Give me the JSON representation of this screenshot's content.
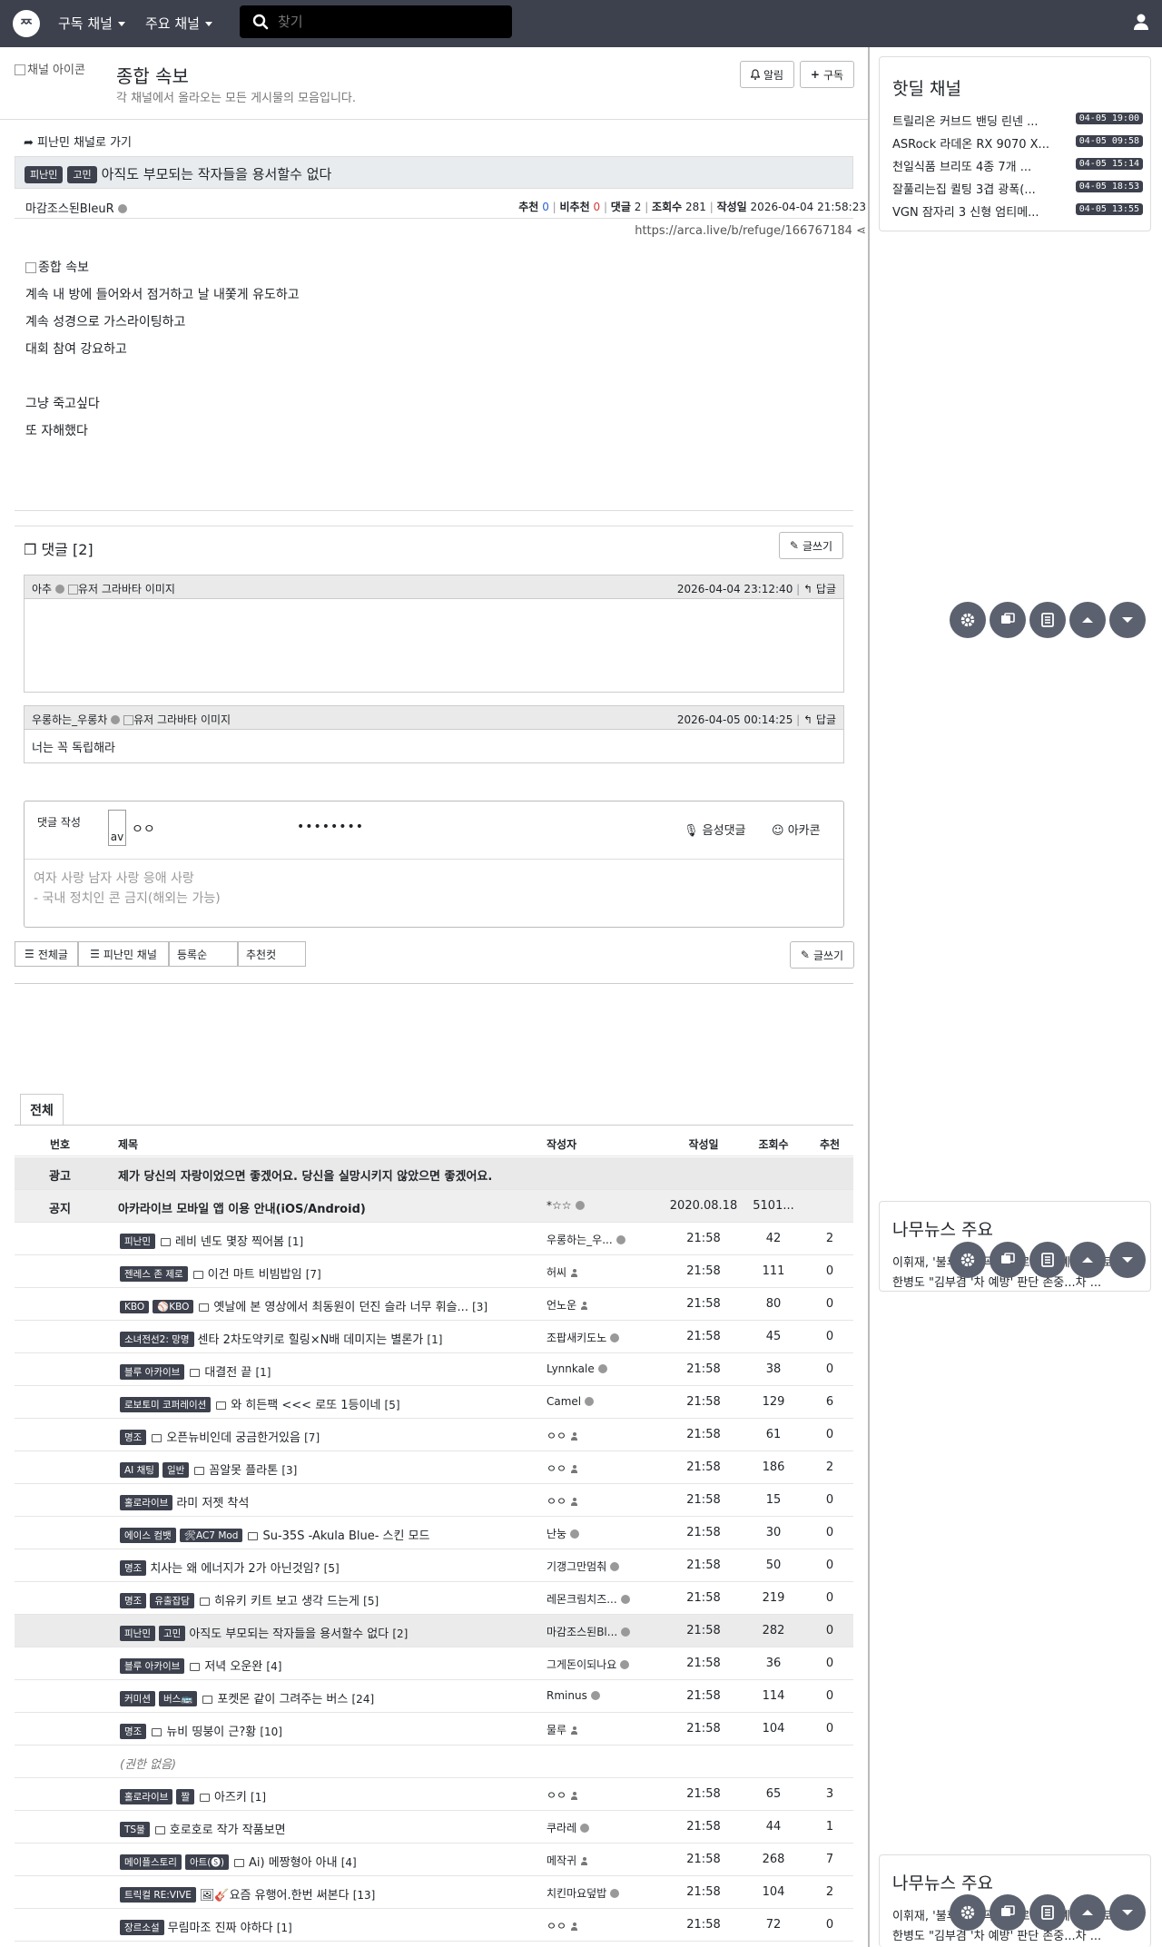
{
  "nav": {
    "logo_text": "ᄍ",
    "subscribed_channels": "구독 채널",
    "major_channels": "주요 채널",
    "search_placeholder": "찾기"
  },
  "header": {
    "channel_icon_alt": "채널 아이콘",
    "title": "종합 속보",
    "subtitle": "각 채널에서 올라오는 모든 게시물의 모음입니다.",
    "alert_label": "알림",
    "subscribe_label": "구독"
  },
  "article": {
    "back_link": "피난민 채널로 가기",
    "badges": [
      "피난민",
      "고민"
    ],
    "title": "아직도 부모되는 작자들을 용서할수 없다",
    "author": "마감조스된BleuR",
    "rec_label": "추천",
    "rec": "0",
    "unrec_label": "비추천",
    "unrec": "0",
    "comments_label": "댓글",
    "comments": "2",
    "views_label": "조회수",
    "views": "281",
    "date_label": "작성일",
    "date": "2026-04-04 21:58:23",
    "url": "https://arca.live/b/refuge/166767184",
    "image_alt": "종합 속보",
    "lines": [
      "계속 내 방에 들어와서 점거하고 날 내쫓게 유도하고",
      "계속 성경으로 가스라이팅하고",
      "대회 참여 강요하고",
      "그냥 죽고싶다",
      "또 자해했다"
    ]
  },
  "comments": {
    "heading": "댓글 [2]",
    "write_label": "글쓰기",
    "reply_label": "답글",
    "avatar_alt": "유저 그라바타 이미지",
    "items": [
      {
        "author": "아추",
        "date": "2026-04-04 23:12:40",
        "text": ""
      },
      {
        "author": "우롱하는_우롱차",
        "date": "2026-04-05 00:14:25",
        "text": "너는 꼭 독립해라"
      }
    ],
    "form": {
      "label": "댓글 작성",
      "avatar_text": "av",
      "nick": "ㅇㅇ",
      "password": "••••••••",
      "voice_label": "음성댓글",
      "arcacon_label": "아카콘",
      "placeholder_1": "여자 사랑 남자 사랑 응애 사랑",
      "placeholder_2": "- 국내 정치인 콘 금지(해외는 가능)"
    }
  },
  "filters": {
    "all": "전체글",
    "channel": "피난민 채널",
    "order": "등록순",
    "best": "추천컷",
    "write": "글쓰기"
  },
  "board": {
    "tab": "전체",
    "headers": {
      "no": "번호",
      "title": "제목",
      "author": "작성자",
      "date": "작성일",
      "views": "조회수",
      "rec": "추천"
    },
    "ad_label": "광고",
    "ad_text": "제가 당신의 자랑이었으면 좋겠어요. 당신을 실망시키지 않았으면 좋겠어요.",
    "notice_label": "공지",
    "notice_title": "아카라이브 모바일 앱 이용 안내(iOS/Android)",
    "notice_author": "*☆☆",
    "notice_date": "2020.08.18",
    "notice_views": "5101...",
    "no_perm": "(권한 없음)",
    "rows": [
      {
        "badges": [
          "피난민"
        ],
        "chip": true,
        "title": "레비 넨도 몇장 찍어봄",
        "cnt": "[1]",
        "author": "우롱하는_우...",
        "atype": "check",
        "date": "21:58",
        "views": "42",
        "rec": "2"
      },
      {
        "badges": [
          "젠레스 존 제로"
        ],
        "chip": true,
        "title": "이건 마트 비빔밥임",
        "cnt": "[7]",
        "author": "허씨",
        "atype": "person",
        "date": "21:58",
        "views": "111",
        "rec": "0"
      },
      {
        "badges": [
          "KBO",
          "⚾KBO"
        ],
        "chip": true,
        "title": "옛날에 본 영상에서 최동원이 던진 슬라 너무 휘슬...",
        "cnt": "[3]",
        "author": "언노운",
        "atype": "person",
        "date": "21:58",
        "views": "80",
        "rec": "0"
      },
      {
        "badges": [
          "소녀전선2: 망명"
        ],
        "chip": false,
        "title": "센타 2차도약키로 힐링×N배 데미지는 별론가",
        "cnt": "[1]",
        "author": "조팝새키도노",
        "atype": "check",
        "date": "21:58",
        "views": "45",
        "rec": "0"
      },
      {
        "badges": [
          "블루 아카이브"
        ],
        "chip": true,
        "title": "대결전 끝",
        "cnt": "[1]",
        "author": "Lynnkale",
        "atype": "check",
        "date": "21:58",
        "views": "38",
        "rec": "0"
      },
      {
        "badges": [
          "로보토미 코퍼레이션"
        ],
        "chip": true,
        "title": "와 히든팩 <<< 로또 1등이네",
        "cnt": "[5]",
        "author": "Camel",
        "atype": "check",
        "date": "21:58",
        "views": "129",
        "rec": "6"
      },
      {
        "badges": [
          "명조"
        ],
        "chip": true,
        "title": "오픈뉴비인데 궁금한거있음",
        "cnt": "[7]",
        "author": "ㅇㅇ",
        "atype": "person",
        "date": "21:58",
        "views": "61",
        "rec": "0"
      },
      {
        "badges": [
          "AI 채팅",
          "일반"
        ],
        "chip": true,
        "title": "꼼알못 플라톤",
        "cnt": "[3]",
        "author": "ㅇㅇ",
        "atype": "person",
        "date": "21:58",
        "views": "186",
        "rec": "2"
      },
      {
        "badges": [
          "홀로라이브"
        ],
        "chip": false,
        "title": "라미 저젯 착석",
        "cnt": "",
        "author": "ㅇㅇ",
        "atype": "person",
        "date": "21:58",
        "views": "15",
        "rec": "0"
      },
      {
        "badges": [
          "에이스 컴뱃",
          "🛠AC7 Mod"
        ],
        "chip": true,
        "title": "Su-35S -Akula Blue- 스킨 모드",
        "cnt": "",
        "author": "난눙",
        "atype": "check",
        "date": "21:58",
        "views": "30",
        "rec": "0"
      },
      {
        "badges": [
          "명조"
        ],
        "chip": false,
        "title": "치사는 왜 에너지가 2가 아닌것임?",
        "cnt": "[5]",
        "author": "기갱그만멈춰",
        "atype": "check",
        "date": "21:58",
        "views": "50",
        "rec": "0"
      },
      {
        "badges": [
          "명조",
          "유출잡담"
        ],
        "chip": true,
        "title": "히유키 키트 보고 생각 드는게",
        "cnt": "[5]",
        "author": "레몬크림치즈...",
        "atype": "check",
        "date": "21:58",
        "views": "219",
        "rec": "0"
      },
      {
        "badges": [
          "피난민",
          "고민"
        ],
        "chip": false,
        "title": "아직도 부모되는 작자들을 용서할수 없다",
        "cnt": "[2]",
        "author": "마감조스된Bl...",
        "atype": "check",
        "date": "21:58",
        "views": "282",
        "rec": "0",
        "active": true
      },
      {
        "badges": [
          "블루 아카이브"
        ],
        "chip": true,
        "title": "저녁 오운완",
        "cnt": "[4]",
        "author": "그게돈이되나요",
        "atype": "check",
        "date": "21:58",
        "views": "36",
        "rec": "0"
      },
      {
        "badges": [
          "커미션",
          "버스🚌"
        ],
        "chip": true,
        "title": "포켓몬 같이 그려주는 버스",
        "cnt": "[24]",
        "author": "Rminus",
        "atype": "check",
        "date": "21:58",
        "views": "114",
        "rec": "0"
      },
      {
        "badges": [
          "명조"
        ],
        "chip": true,
        "title": "뉴비 띵붕이 근?황",
        "cnt": "[10]",
        "author": "물루",
        "atype": "person",
        "date": "21:58",
        "views": "104",
        "rec": "0"
      },
      {
        "noperm": true
      },
      {
        "badges": [
          "홀로라이브",
          "짤"
        ],
        "chip": true,
        "title": "아즈키",
        "cnt": "[1]",
        "author": "ㅇㅇ",
        "atype": "person",
        "date": "21:58",
        "views": "65",
        "rec": "3"
      },
      {
        "badges": [
          "TS물"
        ],
        "chip": true,
        "title": "호로호로 작가 작품보면",
        "cnt": "",
        "author": "쿠라레",
        "atype": "check",
        "date": "21:58",
        "views": "44",
        "rec": "1"
      },
      {
        "badges": [
          "메이플스토리",
          "아트(🅢)"
        ],
        "chip": true,
        "title": "Ai) 메짱형아 아내",
        "cnt": "[4]",
        "author": "메작귀",
        "atype": "person",
        "date": "21:58",
        "views": "268",
        "rec": "7"
      },
      {
        "badges": [
          "트릭컬 RE:VIVE"
        ],
        "chip": false,
        "title": "🖼🎸요즘 유행어.한번 써본다",
        "cnt": "[13]",
        "author": "치킨마요덮밥",
        "atype": "check",
        "date": "21:58",
        "views": "104",
        "rec": "2"
      },
      {
        "badges": [
          "장르소설"
        ],
        "chip": false,
        "title": "무림마조 진짜 야하다",
        "cnt": "[1]",
        "author": "ㅇㅇ",
        "atype": "person",
        "date": "21:58",
        "views": "72",
        "rec": "0"
      }
    ]
  },
  "sidebar": {
    "hotdeal_title": "핫딜 채널",
    "hotdeals": [
      {
        "title": "트릴리온 커브드 밴딩 린넨 ...",
        "time": "04-05 19:00"
      },
      {
        "title": "ASRock 라데온 RX 9070 X...",
        "time": "04-05 09:58"
      },
      {
        "title": "천일식품 브리또 4종 7개 ...",
        "time": "04-05 15:14"
      },
      {
        "title": "잘풀리는집 퀼팅 3겹 광폭(...",
        "time": "04-05 18:53"
      },
      {
        "title": "VGN 잠자리 3 신형 엄티메...",
        "time": "04-05 13:55"
      }
    ],
    "news_title": "나무뉴스 주요",
    "news": [
      "이휘재, '불후의 명곡' MC로 복귀 예정? 프로그램 관계자...",
      "한병도 \"김부겸 '차 예방' 판단 존중...차 ..."
    ]
  }
}
